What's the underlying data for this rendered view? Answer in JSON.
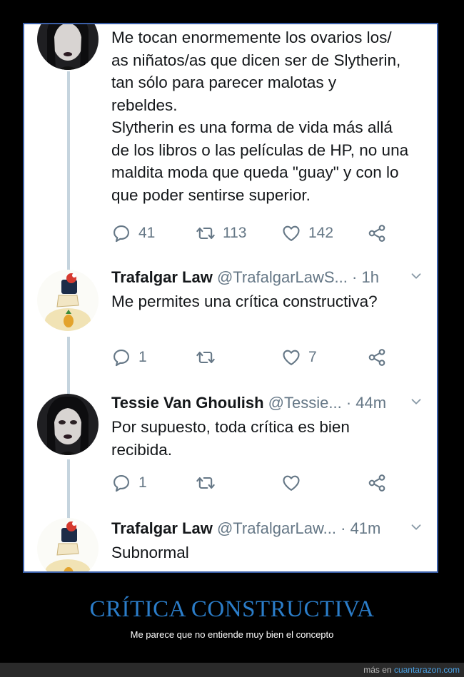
{
  "tweets": [
    {
      "body": "Me tocan enormemente los ovarios los/\nas niñatos/as que dicen ser de Slytherin,\ntan sólo para parecer malotas y\nrebeldes.\nSlytherin es una forma de vida más allá\nde los libros o las películas de HP, no una\nmaldita moda que queda \"guay\" y con lo\nque poder sentirse superior.",
      "replies": "41",
      "retweets": "113",
      "likes": "142"
    },
    {
      "name": "Trafalgar Law",
      "handle": "@TrafalgarLawS...",
      "time": "· 1h",
      "body": "Me permites una crítica constructiva?",
      "replies": "1",
      "retweets": "",
      "likes": "7"
    },
    {
      "name": "Tessie Van Ghoulish",
      "handle": "@Tessie...",
      "time": "· 44m",
      "body": "Por supuesto, toda crítica es bien\nrecibida.",
      "replies": "1",
      "retweets": "",
      "likes": ""
    },
    {
      "name": "Trafalgar Law",
      "handle": "@TrafalgarLaw...",
      "time": "· 41m",
      "body": "Subnormal"
    }
  ],
  "caption": {
    "title": "CRÍTICA CONSTRUCTIVA",
    "subtitle": "Me parece que no entiende muy bien el concepto"
  },
  "footer": {
    "prefix": "más en",
    "site": "cuantarazon.com"
  },
  "colors": {
    "accent_title": "#2b7dc9",
    "frame_border": "#3b5fa8",
    "muted": "#657786",
    "thread_line": "#c5d4de"
  },
  "icons": [
    "reply-icon",
    "retweet-icon",
    "like-icon",
    "share-icon",
    "chevron-down-icon"
  ]
}
